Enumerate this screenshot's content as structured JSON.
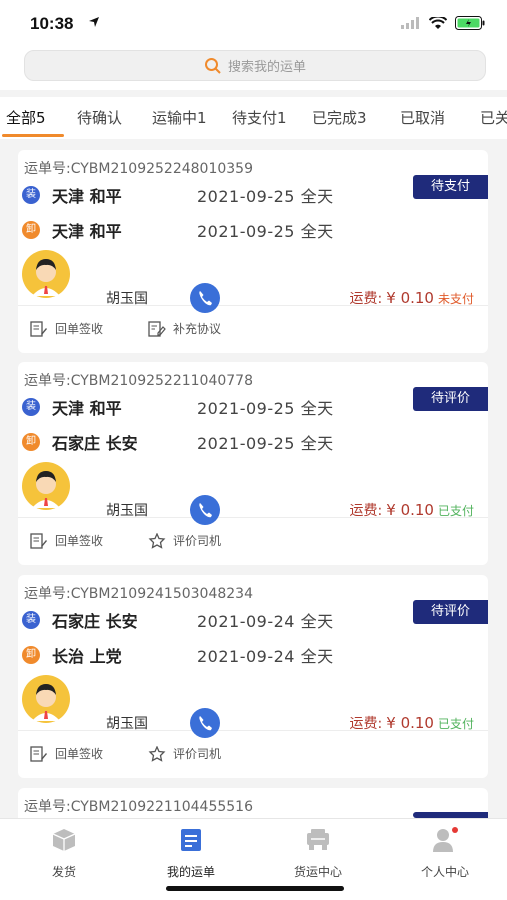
{
  "status_bar": {
    "time": "10:38"
  },
  "search": {
    "placeholder": "搜索我的运单"
  },
  "tabs": [
    {
      "label": "全部5",
      "active": true
    },
    {
      "label": "待确认"
    },
    {
      "label": "运输中1"
    },
    {
      "label": "待支付1"
    },
    {
      "label": "已完成3"
    },
    {
      "label": "已取消"
    },
    {
      "label": "已关"
    }
  ],
  "orders": [
    {
      "order_no": "运单号:CYBM210925224801035​9",
      "status": "待支付",
      "load_badge": "装",
      "unload_badge": "卸",
      "load_city": "天津 和平",
      "load_date": "2021-09-25 全天",
      "unload_city": "天津 和平",
      "unload_date": "2021-09-25 全天",
      "driver": "胡玉国",
      "fee_label": "运费:",
      "fee_value": "¥ 0.10",
      "pay_state": "未支付",
      "actions": [
        "回单签收",
        "补充协议"
      ]
    },
    {
      "order_no": "运单号:CYBM2109252211040778",
      "status": "待评价",
      "load_badge": "装",
      "unload_badge": "卸",
      "load_city": "天津 和平",
      "load_date": "2021-09-25 全天",
      "unload_city": "石家庄 长安",
      "unload_date": "2021-09-25 全天",
      "driver": "胡玉国",
      "fee_label": "运费:",
      "fee_value": "¥ 0.10",
      "pay_state": "已支付",
      "actions": [
        "回单签收",
        "评价司机"
      ]
    },
    {
      "order_no": "运单号:CYBM2109241503048234",
      "status": "待评价",
      "load_badge": "装",
      "unload_badge": "卸",
      "load_city": "石家庄 长安",
      "load_date": "2021-09-24 全天",
      "unload_city": "长治 上党",
      "unload_date": "2021-09-24 全天",
      "driver": "胡玉国",
      "fee_label": "运费:",
      "fee_value": "¥ 0.10",
      "pay_state": "已支付",
      "actions": [
        "回单签收",
        "评价司机"
      ]
    },
    {
      "order_no": "运单号:CYBM2109221104455516"
    }
  ],
  "bottom_nav": [
    {
      "label": "发货",
      "icon": "box-icon"
    },
    {
      "label": "我的运单",
      "icon": "waybill-icon",
      "active": true
    },
    {
      "label": "货运中心",
      "icon": "truck-icon"
    },
    {
      "label": "个人中心",
      "icon": "user-icon"
    }
  ],
  "colors": {
    "accent": "#f08a2c",
    "tag": "#1f2b7b",
    "load": "#3a62d0",
    "fee": "#b03a2e",
    "paid": "#52b35e",
    "unpaid": "#e05a2a"
  }
}
